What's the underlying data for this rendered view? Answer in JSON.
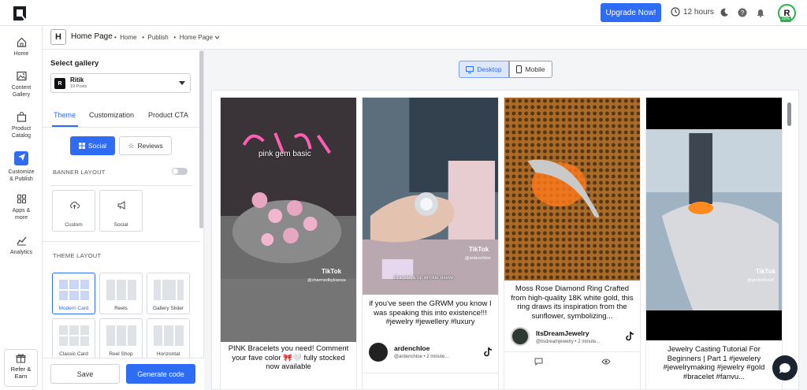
{
  "topbar": {
    "upgrade_label": "Upgrade Now!",
    "timer_label": "12 hours",
    "avatar_letter": "R",
    "avatar_progress": "20%"
  },
  "sidebar": {
    "items": [
      {
        "label": "Home",
        "icon": "home-icon"
      },
      {
        "label": "Content Gallery",
        "icon": "image-icon"
      },
      {
        "label": "Product Catalog",
        "icon": "bag-icon"
      },
      {
        "label": "Customize & Publish",
        "icon": "send-icon"
      },
      {
        "label": "Apps & more",
        "icon": "grid-icon"
      },
      {
        "label": "Analytics",
        "icon": "analytics-icon"
      }
    ],
    "refer_label": "Refer & Earn"
  },
  "breadcrumb": {
    "badge": "H",
    "title": "Home Page",
    "items": [
      "Home",
      "Publish",
      "Home Page"
    ]
  },
  "panel": {
    "select_gallery_label": "Select gallery",
    "gallery": {
      "letter": "R",
      "name": "Ritik",
      "posts": "19 Posts"
    },
    "tabs": [
      "Theme",
      "Customization",
      "Product CTA"
    ],
    "source_buttons": [
      "Social",
      "Reviews"
    ],
    "banner_layout_label": "BANNER LAYOUT",
    "banner_options": [
      "Custom",
      "Social"
    ],
    "theme_layout_label": "THEME LAYOUT",
    "theme_options": [
      "Modern Card",
      "Reels",
      "Gallery Slider",
      "Classic Card",
      "Reel Shop",
      "Horizontal"
    ],
    "save_label": "Save",
    "generate_label": "Generate code"
  },
  "preview": {
    "view_toggle": [
      "Desktop",
      "Mobile"
    ],
    "posts": [
      {
        "overlay": "pink gem basic",
        "tiktok": "TikTok",
        "handle": "@charmedbykiansa",
        "caption": "PINK Bracelets you need! Comment your fave color 🎀🤍 fully stocked now available"
      },
      {
        "overlay": "Bracelet & up wrinkle sleeve",
        "tiktok": "TikTok",
        "handle": "@ardenchloe",
        "caption": "if you've seen the GRWM you know I was speaking this into existence!!! #jewelry #jewellery #luxury",
        "user": "ardenchloe",
        "meta": "@ardenchloe • 2 minute..."
      },
      {
        "caption": "Moss Rose Diamond Ring Crafted from high-quality 18K white gold, this ring draws its inspiration from the sunflower, symbolizing...",
        "user": "ItsDreamJewelry",
        "meta": "@itsdreamjewelry • 2 minute..."
      },
      {
        "tiktok": "TikTok",
        "handle": "@grottodvze8",
        "caption": "Jewelry Casting Tutorial For Beginners | Part 1 #jewelery #jewelrymaking #jewelry #gold #bracelet #fanvu..."
      }
    ]
  },
  "colors": {
    "accent": "#2f6cf6",
    "success": "#2bb24c"
  }
}
